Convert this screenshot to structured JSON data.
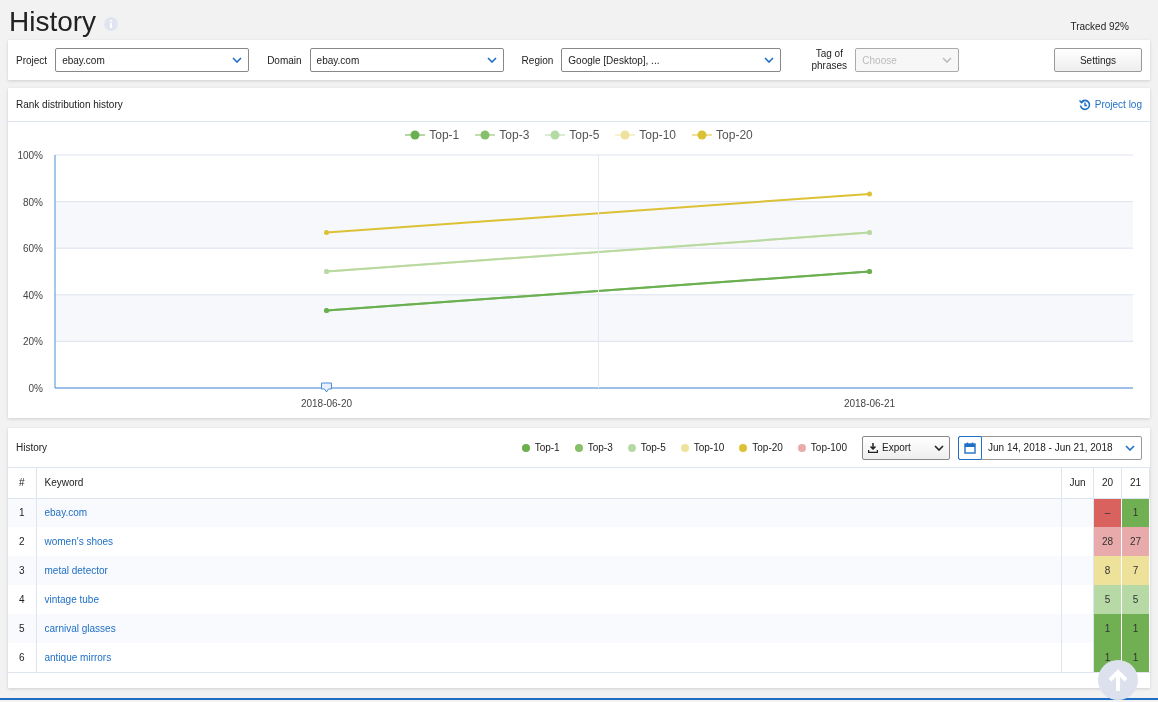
{
  "page": {
    "title": "History",
    "tracked": "Tracked 92%"
  },
  "filters": [
    {
      "label": "Project",
      "value": "ebay.com"
    },
    {
      "label": "Domain",
      "value": "ebay.com"
    },
    {
      "label": "Region",
      "value": "Google [Desktop], ..."
    }
  ],
  "tag_filter": {
    "label": "Tag of phrases",
    "placeholder": "Choose",
    "disabled": true
  },
  "settings_button": "Settings",
  "rank_chart": {
    "title": "Rank distribution history",
    "project_log": "Project log",
    "chart_data": {
      "type": "line",
      "grid": true,
      "legend": true,
      "categories": [
        "2018-06-20",
        "2018-06-21"
      ],
      "ylim": [
        0,
        100
      ],
      "yticks": [
        {
          "value": 0,
          "label": "0%"
        },
        {
          "value": 20,
          "label": "20%"
        },
        {
          "value": 40,
          "label": "40%"
        },
        {
          "value": 60,
          "label": "60%"
        },
        {
          "value": 80,
          "label": "80%"
        },
        {
          "value": 100,
          "label": "100%"
        }
      ],
      "series": [
        {
          "name": "Top-1",
          "color": "#6aaf50",
          "values": [
            33.3,
            50
          ]
        },
        {
          "name": "Top-3",
          "color": "#86c06a",
          "values": [
            33.3,
            50
          ]
        },
        {
          "name": "Top-5",
          "color": "#b6daa5",
          "values": [
            50,
            66.7
          ]
        },
        {
          "name": "Top-10",
          "color": "#eee29c",
          "values": [
            50,
            66.7
          ]
        },
        {
          "name": "Top-20",
          "color": "#dcc135",
          "values": [
            66.7,
            83.3
          ]
        }
      ]
    }
  },
  "history": {
    "title": "History",
    "legend": [
      {
        "label": "Top-1",
        "color": "#6aaf50"
      },
      {
        "label": "Top-3",
        "color": "#86c06a"
      },
      {
        "label": "Top-5",
        "color": "#b6daa5"
      },
      {
        "label": "Top-10",
        "color": "#eee29c"
      },
      {
        "label": "Top-20",
        "color": "#dcc135"
      },
      {
        "label": "Top-100",
        "color": "#e8aaaa"
      }
    ],
    "export": "Export",
    "date_range": "Jun 14, 2018 - Jun 21, 2018",
    "columns": [
      "#",
      "Keyword",
      "Jun",
      "20",
      "21"
    ],
    "rows": [
      {
        "index": "1",
        "keyword": "ebay.com",
        "cells": [
          {
            "value": "–",
            "color": "#d9625f"
          },
          {
            "value": "1",
            "color": "#70b053"
          }
        ]
      },
      {
        "index": "2",
        "keyword": "women's shoes",
        "cells": [
          {
            "value": "28",
            "color": "#e8aaaa"
          },
          {
            "value": "27",
            "color": "#e8aaaa"
          }
        ]
      },
      {
        "index": "3",
        "keyword": "metal detector",
        "cells": [
          {
            "value": "8",
            "color": "#eee19a"
          },
          {
            "value": "7",
            "color": "#eee19a"
          }
        ]
      },
      {
        "index": "4",
        "keyword": "vintage tube",
        "cells": [
          {
            "value": "5",
            "color": "#b7d9a6"
          },
          {
            "value": "5",
            "color": "#b7d9a6"
          }
        ]
      },
      {
        "index": "5",
        "keyword": "carnival glasses",
        "cells": [
          {
            "value": "1",
            "color": "#70b053"
          },
          {
            "value": "1",
            "color": "#70b053"
          }
        ]
      },
      {
        "index": "6",
        "keyword": "antique mirrors",
        "cells": [
          {
            "value": "1",
            "color": "#70b053"
          },
          {
            "value": "1",
            "color": "#70b053"
          }
        ]
      }
    ]
  }
}
